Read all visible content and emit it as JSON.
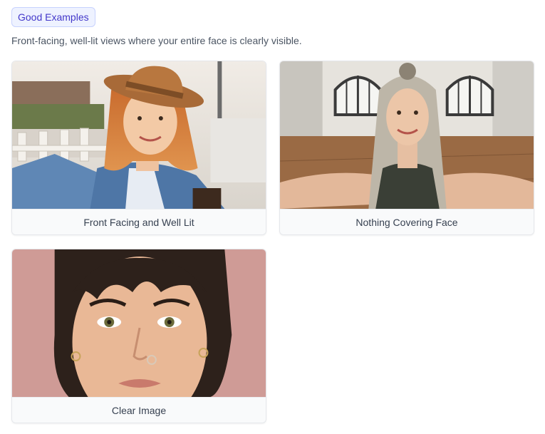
{
  "header": {
    "badge_label": "Good Examples",
    "description": "Front-facing, well-lit views where your entire face is clearly visible."
  },
  "examples": [
    {
      "caption": "Front Facing and Well Lit",
      "image": "selfie-woman-with-hat-photo"
    },
    {
      "caption": "Nothing Covering Face",
      "image": "selfie-woman-in-empty-room-photo"
    },
    {
      "caption": "Clear Image",
      "image": "closeup-woman-face-photo"
    }
  ],
  "colors": {
    "badge_background": "#eef2ff",
    "badge_text": "#4338ca",
    "card_caption_background": "#f9fafb"
  }
}
